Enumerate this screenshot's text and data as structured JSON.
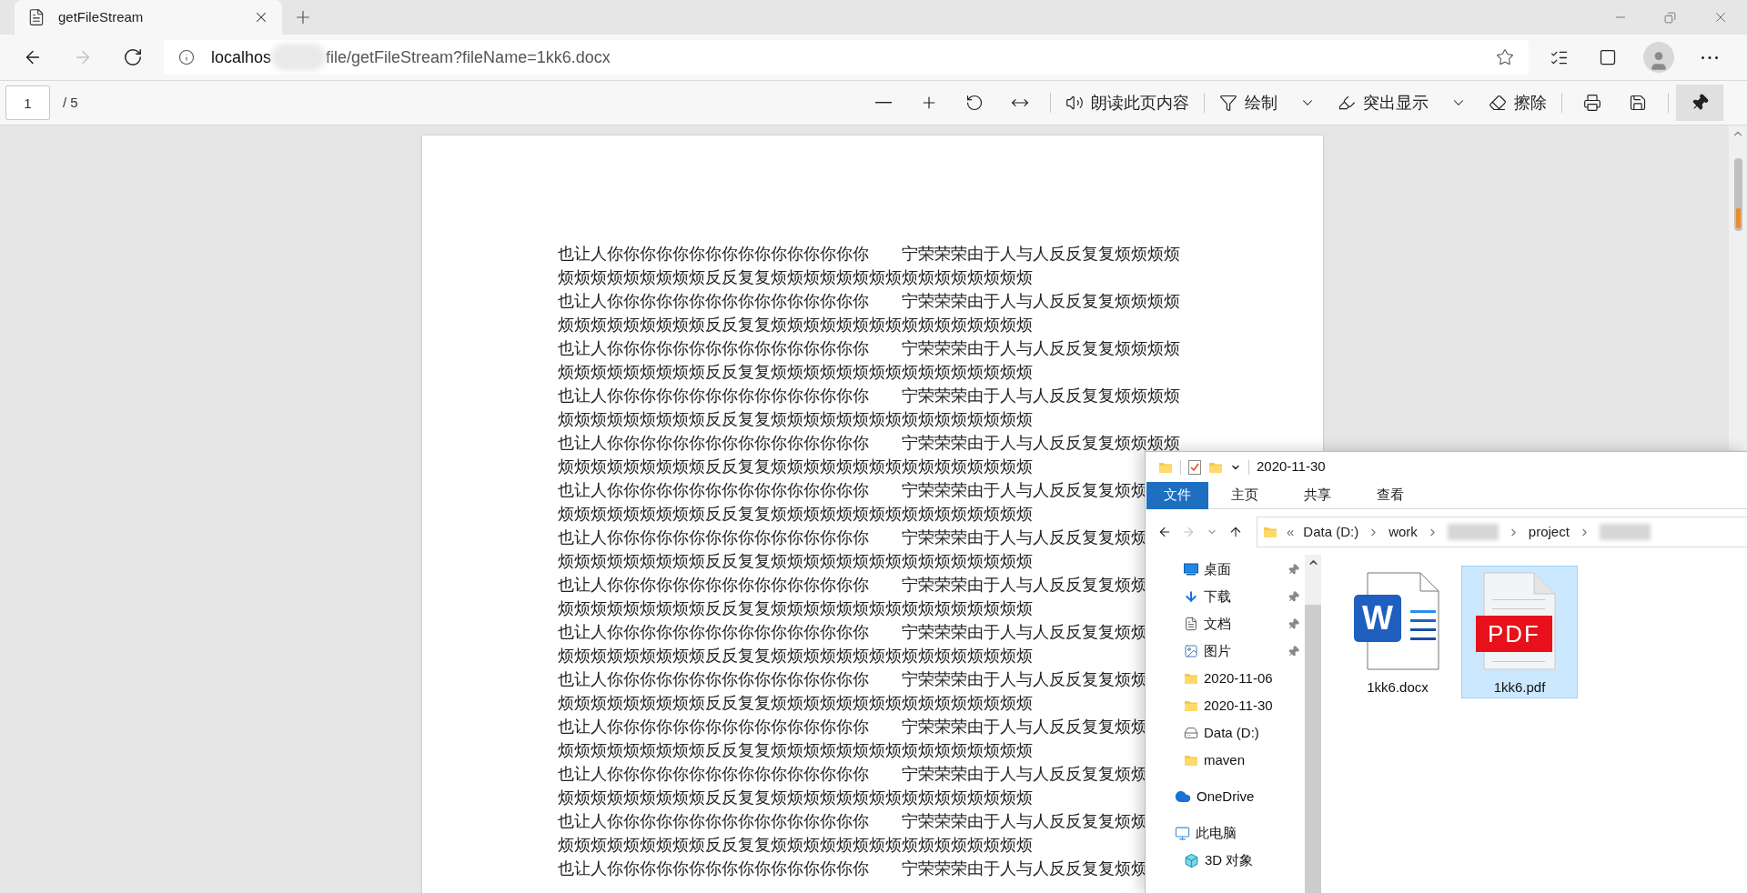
{
  "browser": {
    "tabs": [
      {
        "title": "getFileStream",
        "selected": true
      }
    ],
    "nav": [
      {
        "kind": "back",
        "disabled": false
      },
      {
        "kind": "forward",
        "disabled": true
      },
      {
        "kind": "refresh",
        "disabled": false
      }
    ],
    "url_host": "localhos",
    "url_path": "file/getFileStream?fileName=1kk6.docx"
  },
  "pdf_toolbar": {
    "page": "1",
    "page_count": "/ 5",
    "tools": [
      {
        "kind": "zoom_out"
      },
      {
        "kind": "zoom_in"
      },
      {
        "kind": "rotate"
      },
      {
        "kind": "fit"
      },
      {
        "kind": "separator"
      },
      {
        "kind": "read",
        "label": "朗读此页内容"
      },
      {
        "kind": "separator"
      },
      {
        "kind": "draw",
        "label": "绘制"
      },
      {
        "kind": "dropdown"
      },
      {
        "kind": "highlight",
        "label": "突出显示"
      },
      {
        "kind": "dropdown"
      },
      {
        "kind": "erase",
        "label": "擦除"
      },
      {
        "kind": "separator"
      },
      {
        "kind": "print"
      },
      {
        "kind": "save"
      },
      {
        "kind": "separator"
      }
    ],
    "pin_button": {
      "on": true
    }
  },
  "document": {
    "lines": [
      "也让人你你你你你你你你你你你你你你你你　　宁荣荣荣由于人与人反反复复烦烦烦烦",
      "烦烦烦烦烦烦烦烦烦反反复复烦烦烦烦烦烦烦烦烦烦烦烦烦烦烦烦",
      "也让人你你你你你你你你你你你你你你你你　　宁荣荣荣由于人与人反反复复烦烦烦烦",
      "烦烦烦烦烦烦烦烦烦反反复复烦烦烦烦烦烦烦烦烦烦烦烦烦烦烦烦",
      "也让人你你你你你你你你你你你你你你你你　　宁荣荣荣由于人与人反反复复烦烦烦烦",
      "烦烦烦烦烦烦烦烦烦反反复复烦烦烦烦烦烦烦烦烦烦烦烦烦烦烦烦",
      "也让人你你你你你你你你你你你你你你你你　　宁荣荣荣由于人与人反反复复烦烦烦烦",
      "烦烦烦烦烦烦烦烦烦反反复复烦烦烦烦烦烦烦烦烦烦烦烦烦烦烦烦",
      "也让人你你你你你你你你你你你你你你你你　　宁荣荣荣由于人与人反反复复烦烦烦烦",
      "烦烦烦烦烦烦烦烦烦反反复复烦烦烦烦烦烦烦烦烦烦烦烦烦烦烦烦",
      "也让人你你你你你你你你你你你你你你你你　　宁荣荣荣由于人与人反反复复烦烦",
      "烦烦烦烦烦烦烦烦烦反反复复烦烦烦烦烦烦烦烦烦烦烦烦烦烦烦烦",
      "也让人你你你你你你你你你你你你你你你你　　宁荣荣荣由于人与人反反复复烦烦",
      "烦烦烦烦烦烦烦烦烦反反复复烦烦烦烦烦烦烦烦烦烦烦烦烦烦烦烦",
      "也让人你你你你你你你你你你你你你你你你　　宁荣荣荣由于人与人反反复复烦烦",
      "烦烦烦烦烦烦烦烦烦反反复复烦烦烦烦烦烦烦烦烦烦烦烦烦烦烦烦",
      "也让人你你你你你你你你你你你你你你你你　　宁荣荣荣由于人与人反反复复烦烦",
      "烦烦烦烦烦烦烦烦烦反反复复烦烦烦烦烦烦烦烦烦烦烦烦烦烦烦烦",
      "也让人你你你你你你你你你你你你你你你你　　宁荣荣荣由于人与人反反复复烦烦",
      "烦烦烦烦烦烦烦烦烦反反复复烦烦烦烦烦烦烦烦烦烦烦烦烦烦烦烦",
      "也让人你你你你你你你你你你你你你你你你　　宁荣荣荣由于人与人反反复复烦烦",
      "烦烦烦烦烦烦烦烦烦反反复复烦烦烦烦烦烦烦烦烦烦烦烦烦烦烦烦",
      "也让人你你你你你你你你你你你你你你你你　　宁荣荣荣由于人与人反反复复烦烦",
      "烦烦烦烦烦烦烦烦烦反反复复烦烦烦烦烦烦烦烦烦烦烦烦烦烦烦烦",
      "也让人你你你你你你你你你你你你你你你你　　宁荣荣荣由于人与人反反复复烦烦",
      "烦烦烦烦烦烦烦烦烦反反复复烦烦烦烦烦烦烦烦烦烦烦烦烦烦烦烦",
      "也让人你你你你你你你你你你你你你你你你　　宁荣荣荣由于人与人反反复复烦烦"
    ]
  },
  "explorer": {
    "title": "2020-11-30",
    "ribbon_tabs": [
      {
        "label": "文件",
        "selected": true
      },
      {
        "label": "主页",
        "selected": false
      },
      {
        "label": "共享",
        "selected": false
      },
      {
        "label": "查看",
        "selected": false
      }
    ],
    "nav": [
      {
        "kind": "back",
        "disabled": false
      },
      {
        "kind": "forward",
        "disabled": true
      },
      {
        "kind": "recent",
        "disabled": false
      },
      {
        "kind": "up",
        "disabled": false
      }
    ],
    "overflow": "«",
    "crumbs": [
      {
        "kind": "folder",
        "label": "Data (D:)"
      },
      {
        "kind": "folder",
        "label": "work"
      },
      {
        "kind": "redacted"
      },
      {
        "kind": "folder",
        "label": "project"
      },
      {
        "kind": "redacted"
      }
    ],
    "tree": [
      {
        "children": [
          {
            "label": "桌面",
            "kind": "desktop",
            "pinned": true
          },
          {
            "label": "下载",
            "kind": "download",
            "pinned": true
          },
          {
            "label": "文档",
            "kind": "documents",
            "pinned": true
          },
          {
            "label": "图片",
            "kind": "pictures",
            "pinned": true
          },
          {
            "label": "2020-11-06",
            "kind": "folder",
            "pinned": false
          },
          {
            "label": "2020-11-30",
            "kind": "folder",
            "pinned": false
          },
          {
            "label": "Data (D:)",
            "kind": "drive",
            "pinned": false
          },
          {
            "label": "maven",
            "kind": "folder",
            "pinned": false
          }
        ]
      },
      {
        "label": "OneDrive",
        "kind": "cloud",
        "pinned": false
      },
      {
        "label": "此电脑",
        "kind": "pc",
        "pinned": false,
        "children": [
          {
            "label": "3D 对象",
            "kind": "cube",
            "pinned": false
          }
        ]
      }
    ],
    "files": [
      {
        "name": "1kk6.docx",
        "kind": "word",
        "badge": "W",
        "selected": false
      },
      {
        "name": "1kk6.pdf",
        "kind": "pdf",
        "badge": "PDF",
        "selected": true
      }
    ]
  }
}
